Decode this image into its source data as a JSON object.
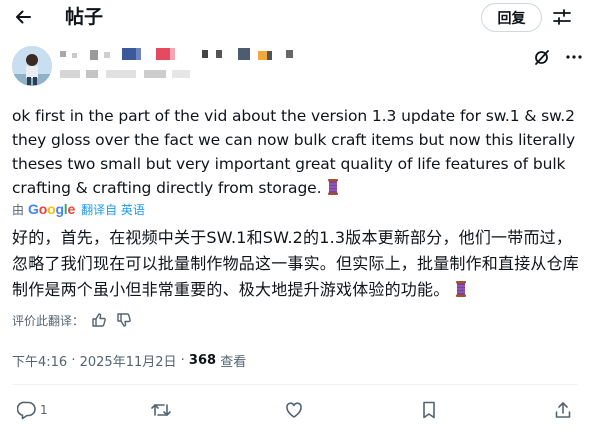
{
  "header": {
    "title": "帖子",
    "reply_label": "回复"
  },
  "tweet": {
    "text": "ok first in the part of the vid about the version 1.3 update for sw.1 & sw.2 they gloss over the fact we can now bulk craft items but now this literally theses two small but very important great quality of life features of bulk crafting & crafting directly from storage.",
    "translated_by_prefix": "由",
    "translated_by_brand": "Google",
    "translated_from": "翻译自 英语",
    "translation": "好的，首先，在视频中关于SW.1和SW.2的1.3版本更新部分，他们一带而过，忽略了我们现在可以批量制作物品这一事实。但实际上，批量制作和直接从仓库制作是两个虽小但非常重要的、极大地提升游戏体验的功能。",
    "rate_translation": "评价此翻译：",
    "time": "下午4:16",
    "date": "2025年11月2日",
    "separator": " · ",
    "views_count": "368",
    "views_label": "查看"
  },
  "actions": {
    "reply_count": "1"
  },
  "colors": {
    "accent": "#1d9bf0",
    "secondary_text": "#536471",
    "primary_text": "#0f1419",
    "border": "#cfd9de"
  }
}
